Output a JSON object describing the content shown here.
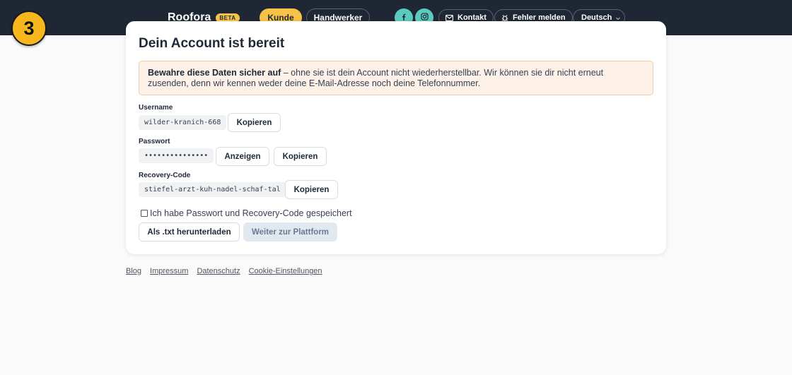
{
  "header": {
    "brand": "Roofora",
    "beta": "BETA",
    "kunde": "Kunde",
    "handwerker": "Handwerker",
    "facebook_icon": "facebook-icon",
    "instagram_icon": "instagram-icon",
    "kontakt": "Kontakt",
    "fehler": "Fehler melden",
    "language": "Deutsch"
  },
  "step": "3",
  "card": {
    "title": "Dein Account ist bereit",
    "notice_bold": "Bewahre diese Daten sicher auf",
    "notice_rest": " – ohne sie ist dein Account nicht wiederherstellbar. Wir können sie dir nicht erneut zusenden, denn wir kennen weder deine E-Mail-Adresse noch deine Telefonnummer.",
    "username_label": "Username",
    "username_value": "wilder-kranich-668",
    "password_label": "Passwort",
    "password_value": "•••••••••••••••",
    "recovery_label": "Recovery-Code",
    "recovery_value": "stiefel-arzt-kuh-nadel-schaf-tal",
    "copy": "Kopieren",
    "show": "Anzeigen",
    "checkbox_label": "Ich habe Passwort und Recovery-Code gespeichert",
    "download": "Als .txt herunterladen",
    "continue": "Weiter zur Plattform"
  },
  "footer": {
    "links": [
      "Blog",
      "Impressum",
      "Datenschutz",
      "Cookie-Einstellungen"
    ]
  },
  "colors": {
    "topbar": "#1e2733",
    "accent": "#f6c348",
    "social": "#5ccbbf"
  }
}
